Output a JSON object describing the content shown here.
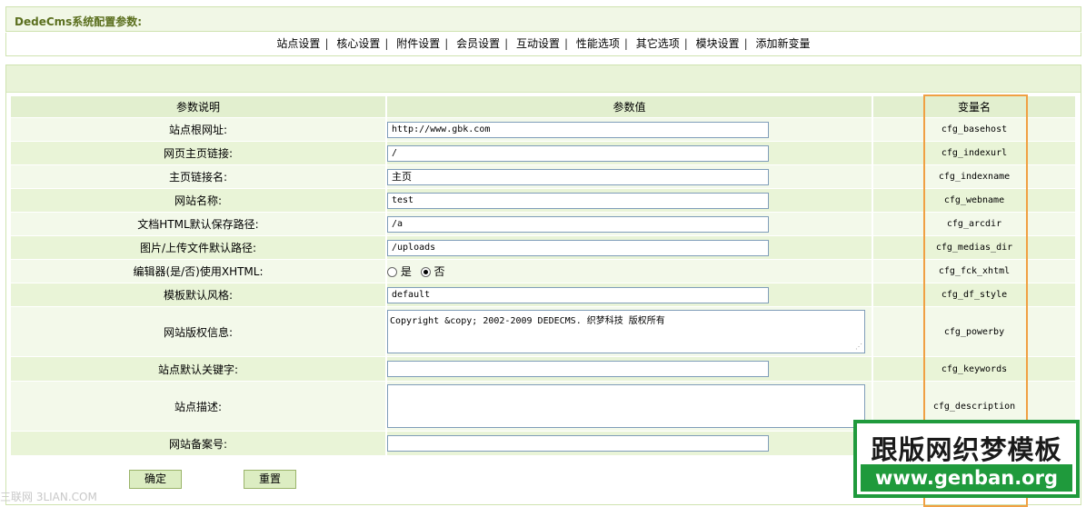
{
  "header": {
    "title": "DedeCms系统配置参数:"
  },
  "nav": [
    "站点设置",
    "核心设置",
    "附件设置",
    "会员设置",
    "互动设置",
    "性能选项",
    "其它选项",
    "模块设置",
    "添加新变量"
  ],
  "table": {
    "headers": {
      "desc": "参数说明",
      "value": "参数值",
      "var": "变量名"
    },
    "rows": [
      {
        "label": "站点根网址:",
        "value": "http://www.gbk.com",
        "var": "cfg_basehost"
      },
      {
        "label": "网页主页链接:",
        "value": "/",
        "var": "cfg_indexurl"
      },
      {
        "label": "主页链接名:",
        "value": "主页",
        "var": "cfg_indexname"
      },
      {
        "label": "网站名称:",
        "value": "test",
        "var": "cfg_webname"
      },
      {
        "label": "文档HTML默认保存路径:",
        "value": "/a",
        "var": "cfg_arcdir"
      },
      {
        "label": "图片/上传文件默认路径:",
        "value": "/uploads",
        "var": "cfg_medias_dir"
      },
      {
        "label": "编辑器(是/否)使用XHTML:",
        "radio_yes": "是",
        "radio_no": "否",
        "var": "cfg_fck_xhtml"
      },
      {
        "label": "模板默认风格:",
        "value": "default",
        "var": "cfg_df_style"
      },
      {
        "label": "网站版权信息:",
        "value": "Copyright &copy; 2002-2009 DEDECMS. 织梦科技 版权所有",
        "var": "cfg_powerby"
      },
      {
        "label": "站点默认关键字:",
        "value": "",
        "var": "cfg_keywords"
      },
      {
        "label": "站点描述:",
        "value": "",
        "var": "cfg_description"
      },
      {
        "label": "网站备案号:",
        "value": "",
        "var": ""
      }
    ]
  },
  "buttons": {
    "confirm": "确定",
    "reset": "重置"
  },
  "watermark": {
    "line1": "跟版网织梦模板",
    "line2": "www.genban.org",
    "corner": "三联网 3LIAN.COM"
  },
  "colors": {
    "accent": "#f0a043",
    "watermark_green": "#1f9a3c",
    "row_bg": "#f3f9ea"
  }
}
